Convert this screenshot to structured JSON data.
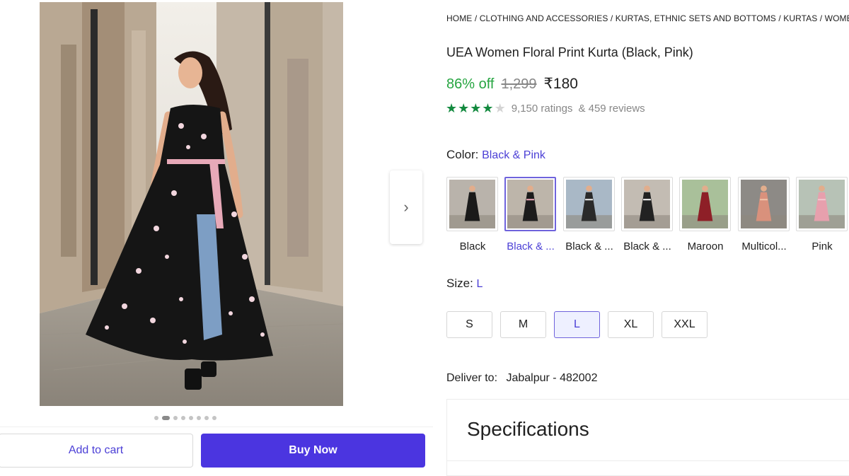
{
  "breadcrumb": "HOME / CLOTHING AND ACCESSORIES / KURTAS, ETHNIC SETS AND BOTTOMS / KURTAS / WOMEN'S KURTAS",
  "product": {
    "title": "UEA Women Floral Print Kurta (Black, Pink)",
    "discount": "86% off",
    "mrp": "1,299",
    "price": "₹180",
    "rating": 4,
    "rating_max": 5,
    "ratings_text": "9,150 ratings",
    "reviews_text": "& 459 reviews"
  },
  "gallery": {
    "image_count": 8,
    "active_index": 1,
    "next_icon": "chevron-right-icon"
  },
  "color": {
    "label": "Color:",
    "selected": "Black & Pink",
    "options": [
      {
        "label": "Black",
        "dress": "#1a1a1a",
        "accent": "#1a1a1a",
        "bg": "#b9b3ab"
      },
      {
        "label": "Black & ...",
        "dress": "#1c1c1c",
        "accent": "#e9a6b7",
        "bg": "#bdb5aa"
      },
      {
        "label": "Black & ...",
        "dress": "#2a2a2a",
        "accent": "#e8e8e8",
        "bg": "#a9b8c6"
      },
      {
        "label": "Black & ...",
        "dress": "#222222",
        "accent": "#f1f1f1",
        "bg": "#c3bcb3"
      },
      {
        "label": "Maroon",
        "dress": "#8e1f27",
        "accent": "#8e1f27",
        "bg": "#a9c09a"
      },
      {
        "label": "Multicol...",
        "dress": "#d9917c",
        "accent": "#f0c2a8",
        "bg": "#8d8a86"
      },
      {
        "label": "Pink",
        "dress": "#e7a0ad",
        "accent": "#f3c6cf",
        "bg": "#b7c2b6"
      }
    ]
  },
  "size": {
    "label": "Size:",
    "selected": "L",
    "options": [
      "S",
      "M",
      "L",
      "XL",
      "XXL"
    ]
  },
  "delivery": {
    "label": "Deliver to:",
    "location": "Jabalpur - 482002"
  },
  "specifications": {
    "title": "Specifications"
  },
  "actions": {
    "add_to_cart": "Add to cart",
    "buy_now": "Buy Now"
  },
  "colors": {
    "accent": "#4b35e0",
    "link": "#4b3fd6",
    "discount_green": "#26a541",
    "star_green": "#138a3f"
  }
}
